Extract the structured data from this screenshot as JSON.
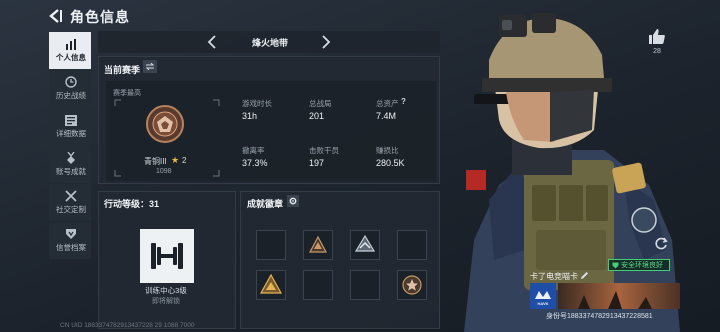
{
  "header": {
    "title": "角色信息"
  },
  "sidebar": {
    "items": [
      {
        "label": "个人信息",
        "icon": "bar-chart-icon",
        "active": true
      },
      {
        "label": "历史战绩",
        "icon": "clock-icon",
        "active": false
      },
      {
        "label": "详细数据",
        "icon": "list-icon",
        "active": false
      },
      {
        "label": "账号成就",
        "icon": "medal-icon",
        "active": false
      },
      {
        "label": "社交定制",
        "icon": "wrench-icon",
        "active": false
      },
      {
        "label": "信誉档案",
        "icon": "shield-icon",
        "active": false
      }
    ]
  },
  "mode": {
    "label": "烽火地带"
  },
  "season": {
    "title": "当前赛季",
    "best_label": "赛季最高",
    "rank_name": "青铜III",
    "rank_level": "2",
    "rank_score": "1098",
    "stats": [
      {
        "label": "游戏时长",
        "value": "31h"
      },
      {
        "label": "总战局",
        "value": "201"
      },
      {
        "label": "总资产",
        "value": "7.4M"
      },
      {
        "label": "撤离率",
        "value": "37.3%"
      },
      {
        "label": "击败干员",
        "value": "197"
      },
      {
        "label": "赚损比",
        "value": "280.5K"
      }
    ],
    "help": "?"
  },
  "level": {
    "title": "行动等级：31",
    "center_name": "训练中心3级",
    "note": "即将解锁"
  },
  "achievements": {
    "title": "成就徽章"
  },
  "social": {
    "likes": "28"
  },
  "card": {
    "secure_label": "安全环境良好",
    "label": "卡了电竞喵卡",
    "logo_text": "HAVK",
    "id": "身份号1883374782913437228581"
  },
  "footer": {
    "text": "CN UID 1883374782913437228 29 1088 7000"
  },
  "colors": {
    "accent": "#e6b94a",
    "secure": "#3ecf79",
    "active_tab": "#e9edf1"
  }
}
